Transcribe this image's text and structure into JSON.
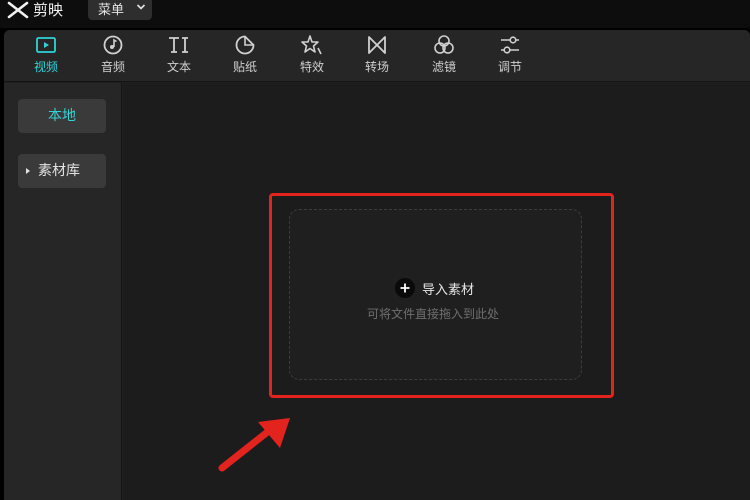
{
  "app": {
    "name": "剪映",
    "menu_label": "菜单"
  },
  "toolbar": {
    "tabs": [
      {
        "label": "视频",
        "icon": "video-icon",
        "active": true
      },
      {
        "label": "音频",
        "icon": "audio-icon",
        "active": false
      },
      {
        "label": "文本",
        "icon": "text-icon",
        "active": false
      },
      {
        "label": "贴纸",
        "icon": "sticker-icon",
        "active": false
      },
      {
        "label": "特效",
        "icon": "effects-icon",
        "active": false
      },
      {
        "label": "转场",
        "icon": "transition-icon",
        "active": false
      },
      {
        "label": "滤镜",
        "icon": "filter-icon",
        "active": false
      },
      {
        "label": "调节",
        "icon": "adjust-icon",
        "active": false
      }
    ]
  },
  "sidebar": {
    "items": [
      {
        "label": "本地",
        "active": true
      },
      {
        "label": "素材库",
        "active": false
      }
    ]
  },
  "import": {
    "label": "导入素材",
    "hint": "可将文件直接拖入到此处"
  },
  "colors": {
    "accent": "#2fd3d8",
    "highlight": "#e3231e"
  }
}
